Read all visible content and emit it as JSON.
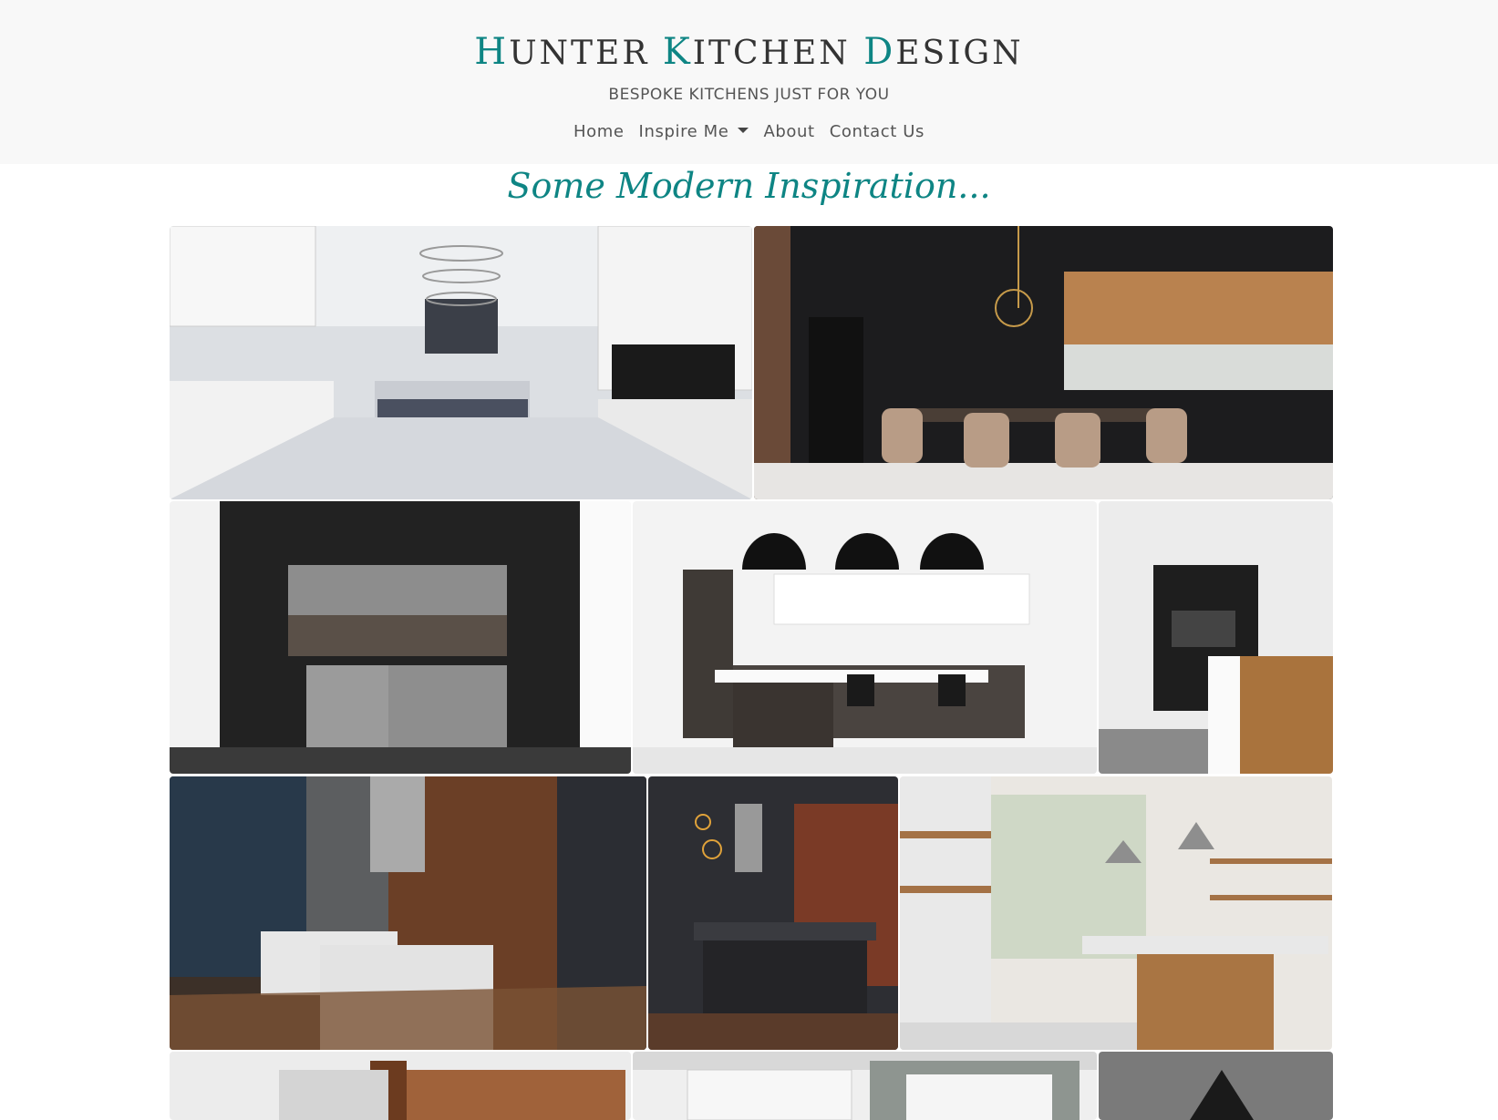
{
  "header": {
    "brand": {
      "word1": {
        "cap": "H",
        "rest": "UNTER"
      },
      "word2": {
        "cap": "K",
        "rest": "ITCHEN"
      },
      "word3": {
        "cap": "D",
        "rest": "ESIGN"
      }
    },
    "tagline": "BESPOKE KITCHENS JUST FOR YOU",
    "nav": {
      "home": "Home",
      "inspire": "Inspire Me",
      "about": "About",
      "contact": "Contact Us"
    }
  },
  "gallery": {
    "title": "Some Modern Inspiration...",
    "accent_color": "#0e8584"
  }
}
